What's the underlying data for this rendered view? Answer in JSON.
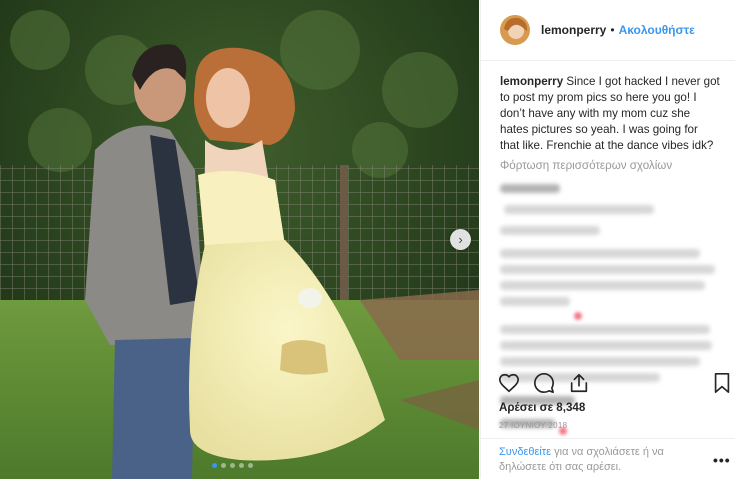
{
  "header": {
    "username": "lemonperry",
    "separator": "•",
    "follow_label": "Ακολουθήστε"
  },
  "caption": {
    "username": "lemonperry",
    "text": "Since I got hacked I never got to post my prom pics so here you go! I don’t have any with my mom cuz she hates pictures so yeah. I was going for that like. Frenchie at the dance vibes idk?"
  },
  "load_more_label": "Φόρτωση περισσότερων σχολίων",
  "carousel": {
    "slide_count": 5,
    "active_index": 0,
    "next_icon": "›"
  },
  "actions": {
    "like_icon": "heart-outline",
    "comment_icon": "speech-bubble",
    "share_icon": "share-arrow",
    "save_icon": "bookmark-outline"
  },
  "likes_label": "Αρέσει σε 8,348",
  "date_label": "27 ΙΟΥΝΙΟΥ 2018",
  "login_prompt": {
    "link_text": "Συνδεθείτε",
    "rest_text": " για να σχολιάσετε ή να δηλώσετε ότι σας αρέσει."
  },
  "more_label": "•••",
  "colors": {
    "accent": "#3897f0",
    "muted": "#999999",
    "text": "#262626"
  }
}
